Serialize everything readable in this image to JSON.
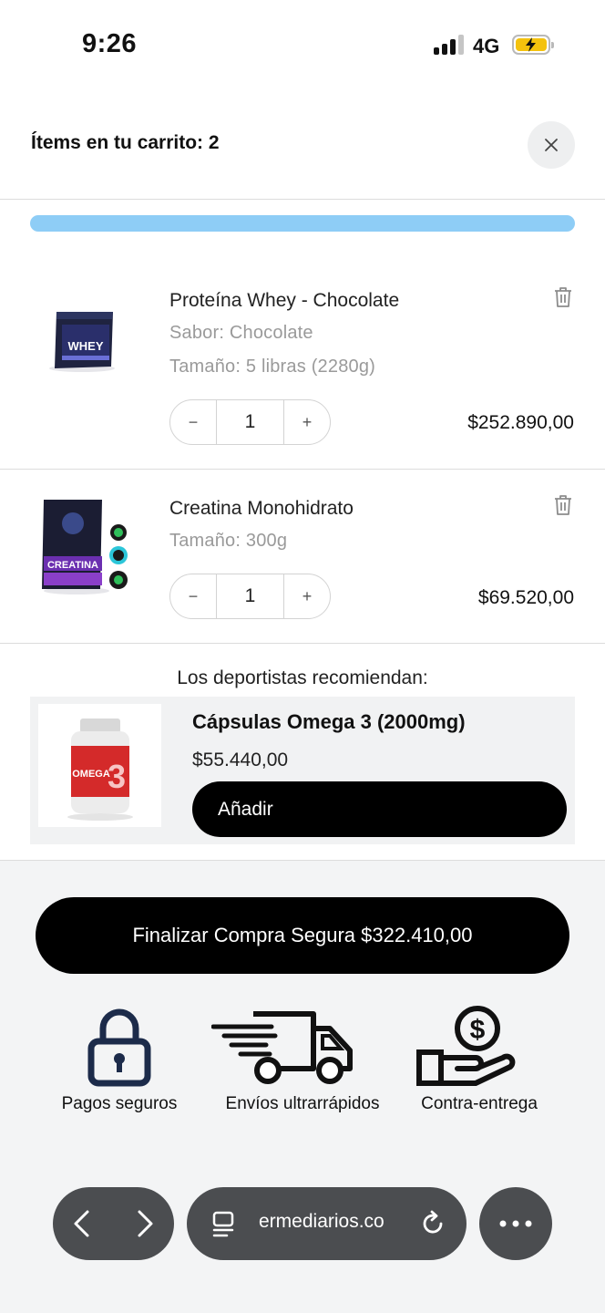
{
  "status_bar": {
    "time": "9:26",
    "network": "4G"
  },
  "cart": {
    "title": "Ítems en tu carrito: 2"
  },
  "items": [
    {
      "name": "Proteína Whey - Chocolate",
      "details": [
        "Sabor: Chocolate",
        "Tamaño: 5 libras (2280g)"
      ],
      "quantity": "1",
      "price": "$252.890,00",
      "image_label": "WHEY"
    },
    {
      "name": "Creatina Monohidrato",
      "details": [
        "Tamaño: 300g"
      ],
      "quantity": "1",
      "price": "$69.520,00",
      "image_label": "CREATINA"
    }
  ],
  "recommendation": {
    "heading": "Los deportistas recomiendan:",
    "name": "Cápsulas Omega 3 (2000mg)",
    "price": "$55.440,00",
    "add_label": "Añadir",
    "image_label": "OMEGA"
  },
  "checkout": {
    "label": "Finalizar Compra Segura $322.410,00"
  },
  "features": [
    {
      "label": "Pagos seguros",
      "icon": "lock-icon"
    },
    {
      "label": "Envíos ultrarrápidos",
      "icon": "truck-icon"
    },
    {
      "label": "Contra-entrega",
      "icon": "hand-coin-icon"
    }
  ],
  "browser": {
    "url": "ermediarios.co"
  },
  "colors": {
    "progress": "#8ecdf6",
    "icon_navy": "#1c2b4a",
    "battery": "#f4c20d"
  }
}
